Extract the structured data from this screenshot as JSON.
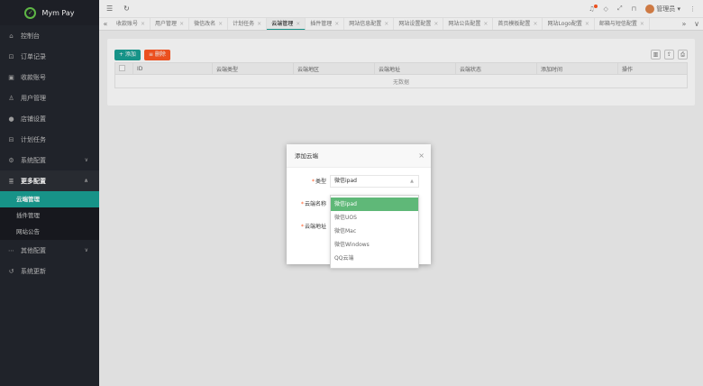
{
  "app": {
    "name": "Mym Pay"
  },
  "sidebar": {
    "items": [
      {
        "label": "控制台",
        "icon": "home-icon"
      },
      {
        "label": "订单记录",
        "icon": "cart-icon"
      },
      {
        "label": "收款账号",
        "icon": "wallet-icon"
      },
      {
        "label": "用户管理",
        "icon": "users-icon"
      },
      {
        "label": "店铺设置",
        "icon": "store-icon"
      },
      {
        "label": "计划任务",
        "icon": "task-icon"
      },
      {
        "label": "系统配置",
        "icon": "gear-icon"
      },
      {
        "label": "更多配置",
        "icon": "list-icon"
      },
      {
        "label": "其他配置",
        "icon": "more-icon"
      },
      {
        "label": "系统更新",
        "icon": "update-icon"
      }
    ],
    "submenu": [
      {
        "label": "云端管理"
      },
      {
        "label": "插件管理"
      },
      {
        "label": "网站公告"
      }
    ]
  },
  "topbar": {
    "admin": "管理员 ▾"
  },
  "tabs": [
    "收款账号",
    "用户管理",
    "微信改名",
    "计划任务",
    "云端管理",
    "插件管理",
    "网站信息配置",
    "网站设置配置",
    "网站公告配置",
    "首页模板配置",
    "网站Logo配置",
    "邮箱与短信配置"
  ],
  "toolbar": {
    "add": "+ 添加",
    "delete": "≡ 删除"
  },
  "table": {
    "headers": [
      "ID",
      "云端类型",
      "云端地区",
      "云端地址",
      "云端状态",
      "添加时间",
      "操作"
    ],
    "empty": "无数据"
  },
  "dialog": {
    "title": "添加云端",
    "close": "×",
    "type_label": "类型",
    "field2_label": "云端名称",
    "field3_label": "云端地址",
    "selected": "微信ipad",
    "options": [
      "微信ipad",
      "微信UOS",
      "微信Mac",
      "微信Windows",
      "QQ云端"
    ]
  },
  "colors": {
    "accent": "#1aa094",
    "danger": "#ff5722",
    "sidebar": "#23262e",
    "option_selected": "#5fb878"
  }
}
